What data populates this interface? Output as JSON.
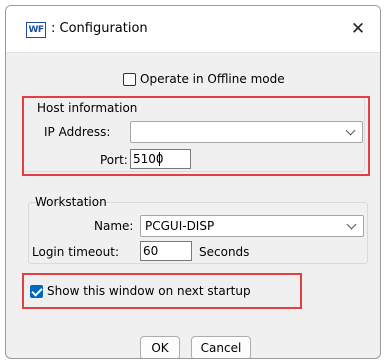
{
  "window": {
    "icon_text": "WF",
    "title": ": Configuration",
    "close_glyph": "✕"
  },
  "offline": {
    "label": "Operate in Offline mode",
    "checked": false
  },
  "host": {
    "group_label": "Host information",
    "ip_label": "IP Address:",
    "ip_value": "",
    "port_label": "Port:",
    "port_value": "5100"
  },
  "workstation": {
    "group_label": "Workstation",
    "name_label": "Name:",
    "name_value": "PCGUI-DISP",
    "timeout_label": "Login timeout:",
    "timeout_value": "60",
    "timeout_unit": "Seconds"
  },
  "startup": {
    "label": "Show this window on next startup",
    "checked": true
  },
  "buttons": {
    "ok": "OK",
    "cancel": "Cancel"
  },
  "colors": {
    "highlight": "#e04040",
    "accent": "#0067c0"
  }
}
